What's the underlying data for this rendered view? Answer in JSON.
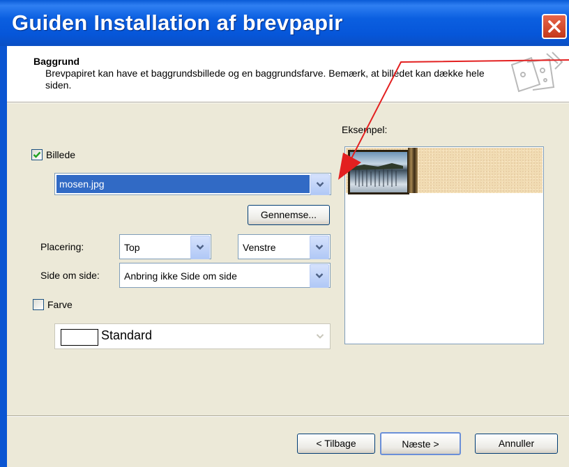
{
  "window": {
    "title": "Guiden Installation af brevpapir"
  },
  "header": {
    "title": "Baggrund",
    "description": "Brevpapiret kan have et baggrundsbillede og en baggrundsfarve. Bemærk, at billedet kan dække hele siden."
  },
  "image": {
    "checkbox_label": "Billede",
    "checked": true,
    "file": "mosen.jpg",
    "browse_label": "Gennemse..."
  },
  "placement": {
    "label": "Placering:",
    "vertical": "Top",
    "horizontal": "Venstre"
  },
  "tile": {
    "label": "Side om side:",
    "value": "Anbring ikke Side om side"
  },
  "color": {
    "checkbox_label": "Farve",
    "checked": false,
    "value": "Standard",
    "swatch": "#ffffff"
  },
  "preview": {
    "label": "Eksempel:"
  },
  "footer": {
    "back_label": "< Tilbage",
    "next_label": "Næste >",
    "cancel_label": "Annuller"
  },
  "colors": {
    "titlebar": "#0a5bd6",
    "dialog_bg": "#ece9d8",
    "selection": "#316ac5",
    "annotation_arrow": "#e32020",
    "close_button": "#d9491f"
  }
}
